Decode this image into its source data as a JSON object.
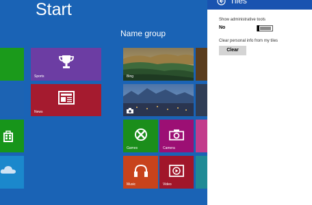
{
  "start": {
    "title": "Start"
  },
  "group": {
    "title": "Name group"
  },
  "tiles": {
    "sports": {
      "label": "Sports",
      "icon": "trophy-icon",
      "color": "#6c3da3"
    },
    "news": {
      "label": "News",
      "icon": "newspaper-icon",
      "color": "#a51b2f"
    },
    "bing": {
      "label": "Bing",
      "icon": "landscape-photo"
    },
    "photos": {
      "label": "",
      "icon": "camera-small-icon"
    },
    "games": {
      "label": "Games",
      "icon": "gamepad-icon",
      "color": "#1b8e1b"
    },
    "camera": {
      "label": "Camera",
      "icon": "camera-icon",
      "color": "#9c0f74"
    },
    "music": {
      "label": "Music",
      "icon": "headphones-icon",
      "color": "#c8431c"
    },
    "video": {
      "label": "Video",
      "icon": "play-icon",
      "color": "#a1162a"
    },
    "store": {
      "icon": "store-bag-icon",
      "color": "#17951a"
    },
    "weather": {
      "icon": "cloud-icon",
      "color": "#1b88cc"
    }
  },
  "panel": {
    "title": "Tiles",
    "admin_tools_label": "Show administrative tools",
    "admin_tools_value": "No",
    "admin_tools_enabled": false,
    "clear_label": "Clear personal info from my tiles",
    "clear_button": "Clear",
    "header_color": "#1953b0"
  },
  "colors": {
    "background": "#1a63b5",
    "green": "#1b9a1b",
    "purple": "#6c3da3",
    "red": "#a51b2f"
  }
}
